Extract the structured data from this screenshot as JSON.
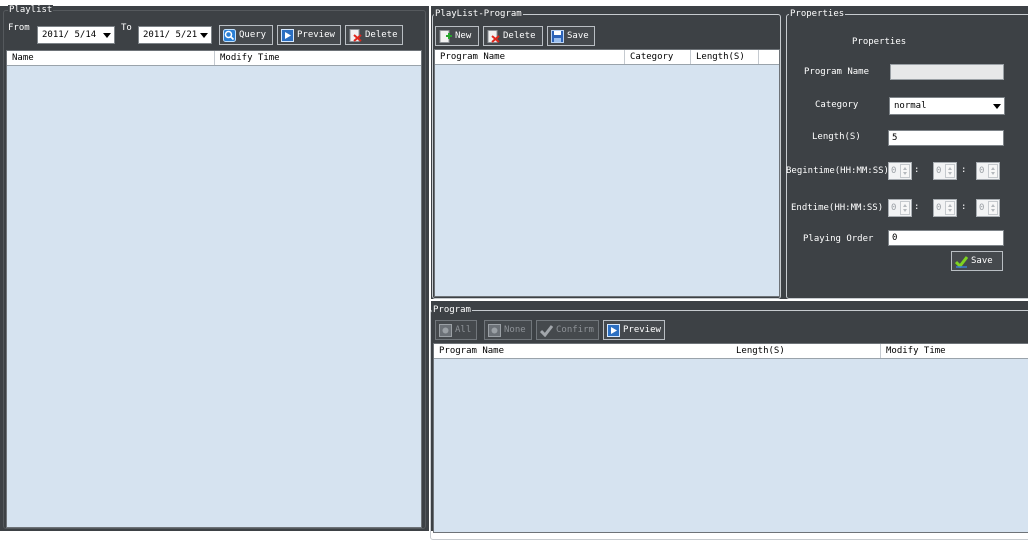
{
  "playlist": {
    "title": "Playlist",
    "from_label": "From",
    "from_date": "2011/ 5/14",
    "to_label": "To",
    "to_date": "2011/ 5/21",
    "query_label": "Query",
    "preview_label": "Preview",
    "delete_label": "Delete",
    "columns": [
      "Name",
      "Modify Time"
    ]
  },
  "playlist_program": {
    "title": "PlayList-Program",
    "new_label": "New",
    "delete_label": "Delete",
    "save_label": "Save",
    "columns": [
      "Program Name",
      "Category",
      "Length(S)"
    ]
  },
  "properties": {
    "title": "Properties",
    "heading": "Properties",
    "program_name_label": "Program Name",
    "program_name_value": "",
    "category_label": "Category",
    "category_value": "normal",
    "length_label": "Length(S)",
    "length_value": "5",
    "begintime_label": "Begintime(HH:MM:SS)",
    "begintime": [
      "0",
      "0",
      "0"
    ],
    "endtime_label": "Endtime(HH:MM:SS)",
    "endtime": [
      "0",
      "0",
      "0"
    ],
    "playing_order_label": "Playing Order",
    "playing_order_value": "0",
    "save_label": "Save",
    "colon": ":"
  },
  "program": {
    "title": "Program",
    "all_label": "All",
    "none_label": "None",
    "confirm_label": "Confirm",
    "preview_label": "Preview",
    "columns": [
      "Program Name",
      "Length(S)",
      "Modify Time"
    ]
  },
  "colors": {
    "panel_bg": "#3d4145",
    "list_bg": "#d6e3f0",
    "header_bg": "#ffffff"
  }
}
